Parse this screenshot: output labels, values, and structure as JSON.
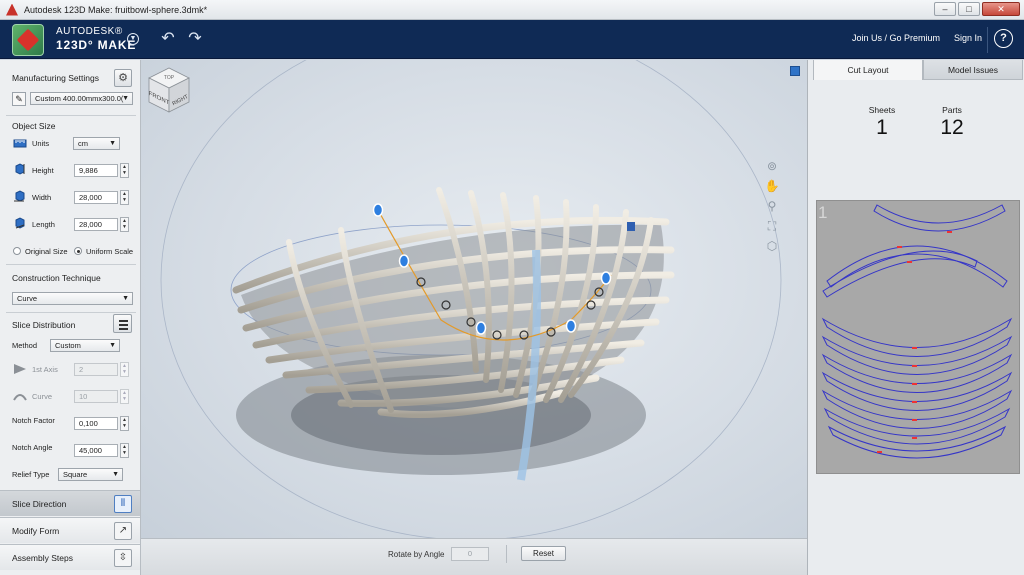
{
  "window": {
    "title": "Autodesk 123D Make: fruitbowl-sphere.3dmk*",
    "minimize": "–",
    "maximize": "□",
    "close": "✕"
  },
  "header": {
    "brand_line1": "AUTODESK®",
    "brand_line2": "123D° MAKE",
    "join_link": "Join Us / Go Premium",
    "signin_link": "Sign In",
    "help": "?"
  },
  "left": {
    "manufacturing": {
      "title": "Manufacturing Settings",
      "preset": "Custom 400.00mmx300.0("
    },
    "object_size": {
      "title": "Object Size",
      "units_label": "Units",
      "units_value": "cm",
      "height_label": "Height",
      "height_value": "9,886",
      "width_label": "Width",
      "width_value": "28,000",
      "length_label": "Length",
      "length_value": "28,000",
      "original_size": "Original Size",
      "uniform_scale": "Uniform Scale"
    },
    "construction": {
      "title": "Construction Technique",
      "value": "Curve"
    },
    "slice": {
      "title": "Slice Distribution",
      "method_label": "Method",
      "method_value": "Custom",
      "axis_label": "1st Axis",
      "axis_value": "2",
      "curve_label": "Curve",
      "curve_value": "10",
      "notch_factor_label": "Notch Factor",
      "notch_factor_value": "0,100",
      "notch_angle_label": "Notch Angle",
      "notch_angle_value": "45,000",
      "relief_label": "Relief Type",
      "relief_value": "Square"
    },
    "tabs": {
      "slice_direction": "Slice Direction",
      "modify_form": "Modify Form",
      "assembly_steps": "Assembly Steps"
    }
  },
  "viewport": {
    "cube_top": "TOP",
    "cube_front": "FRONT",
    "cube_right": "RIGHT"
  },
  "rotate_bar": {
    "label": "Rotate by  Angle",
    "angle_value": "0",
    "reset": "Reset"
  },
  "right": {
    "tab_cut_layout": "Cut Layout",
    "tab_model_issues": "Model Issues",
    "sheets_label": "Sheets",
    "sheets_value": "1",
    "parts_label": "Parts",
    "parts_value": "12",
    "sheet_number": "1"
  },
  "colors": {
    "header_bg": "#0f2a55",
    "accent_blue": "#2f73c7",
    "cut_line": "#3535c8",
    "sheet_bg": "#a8a8a8"
  }
}
